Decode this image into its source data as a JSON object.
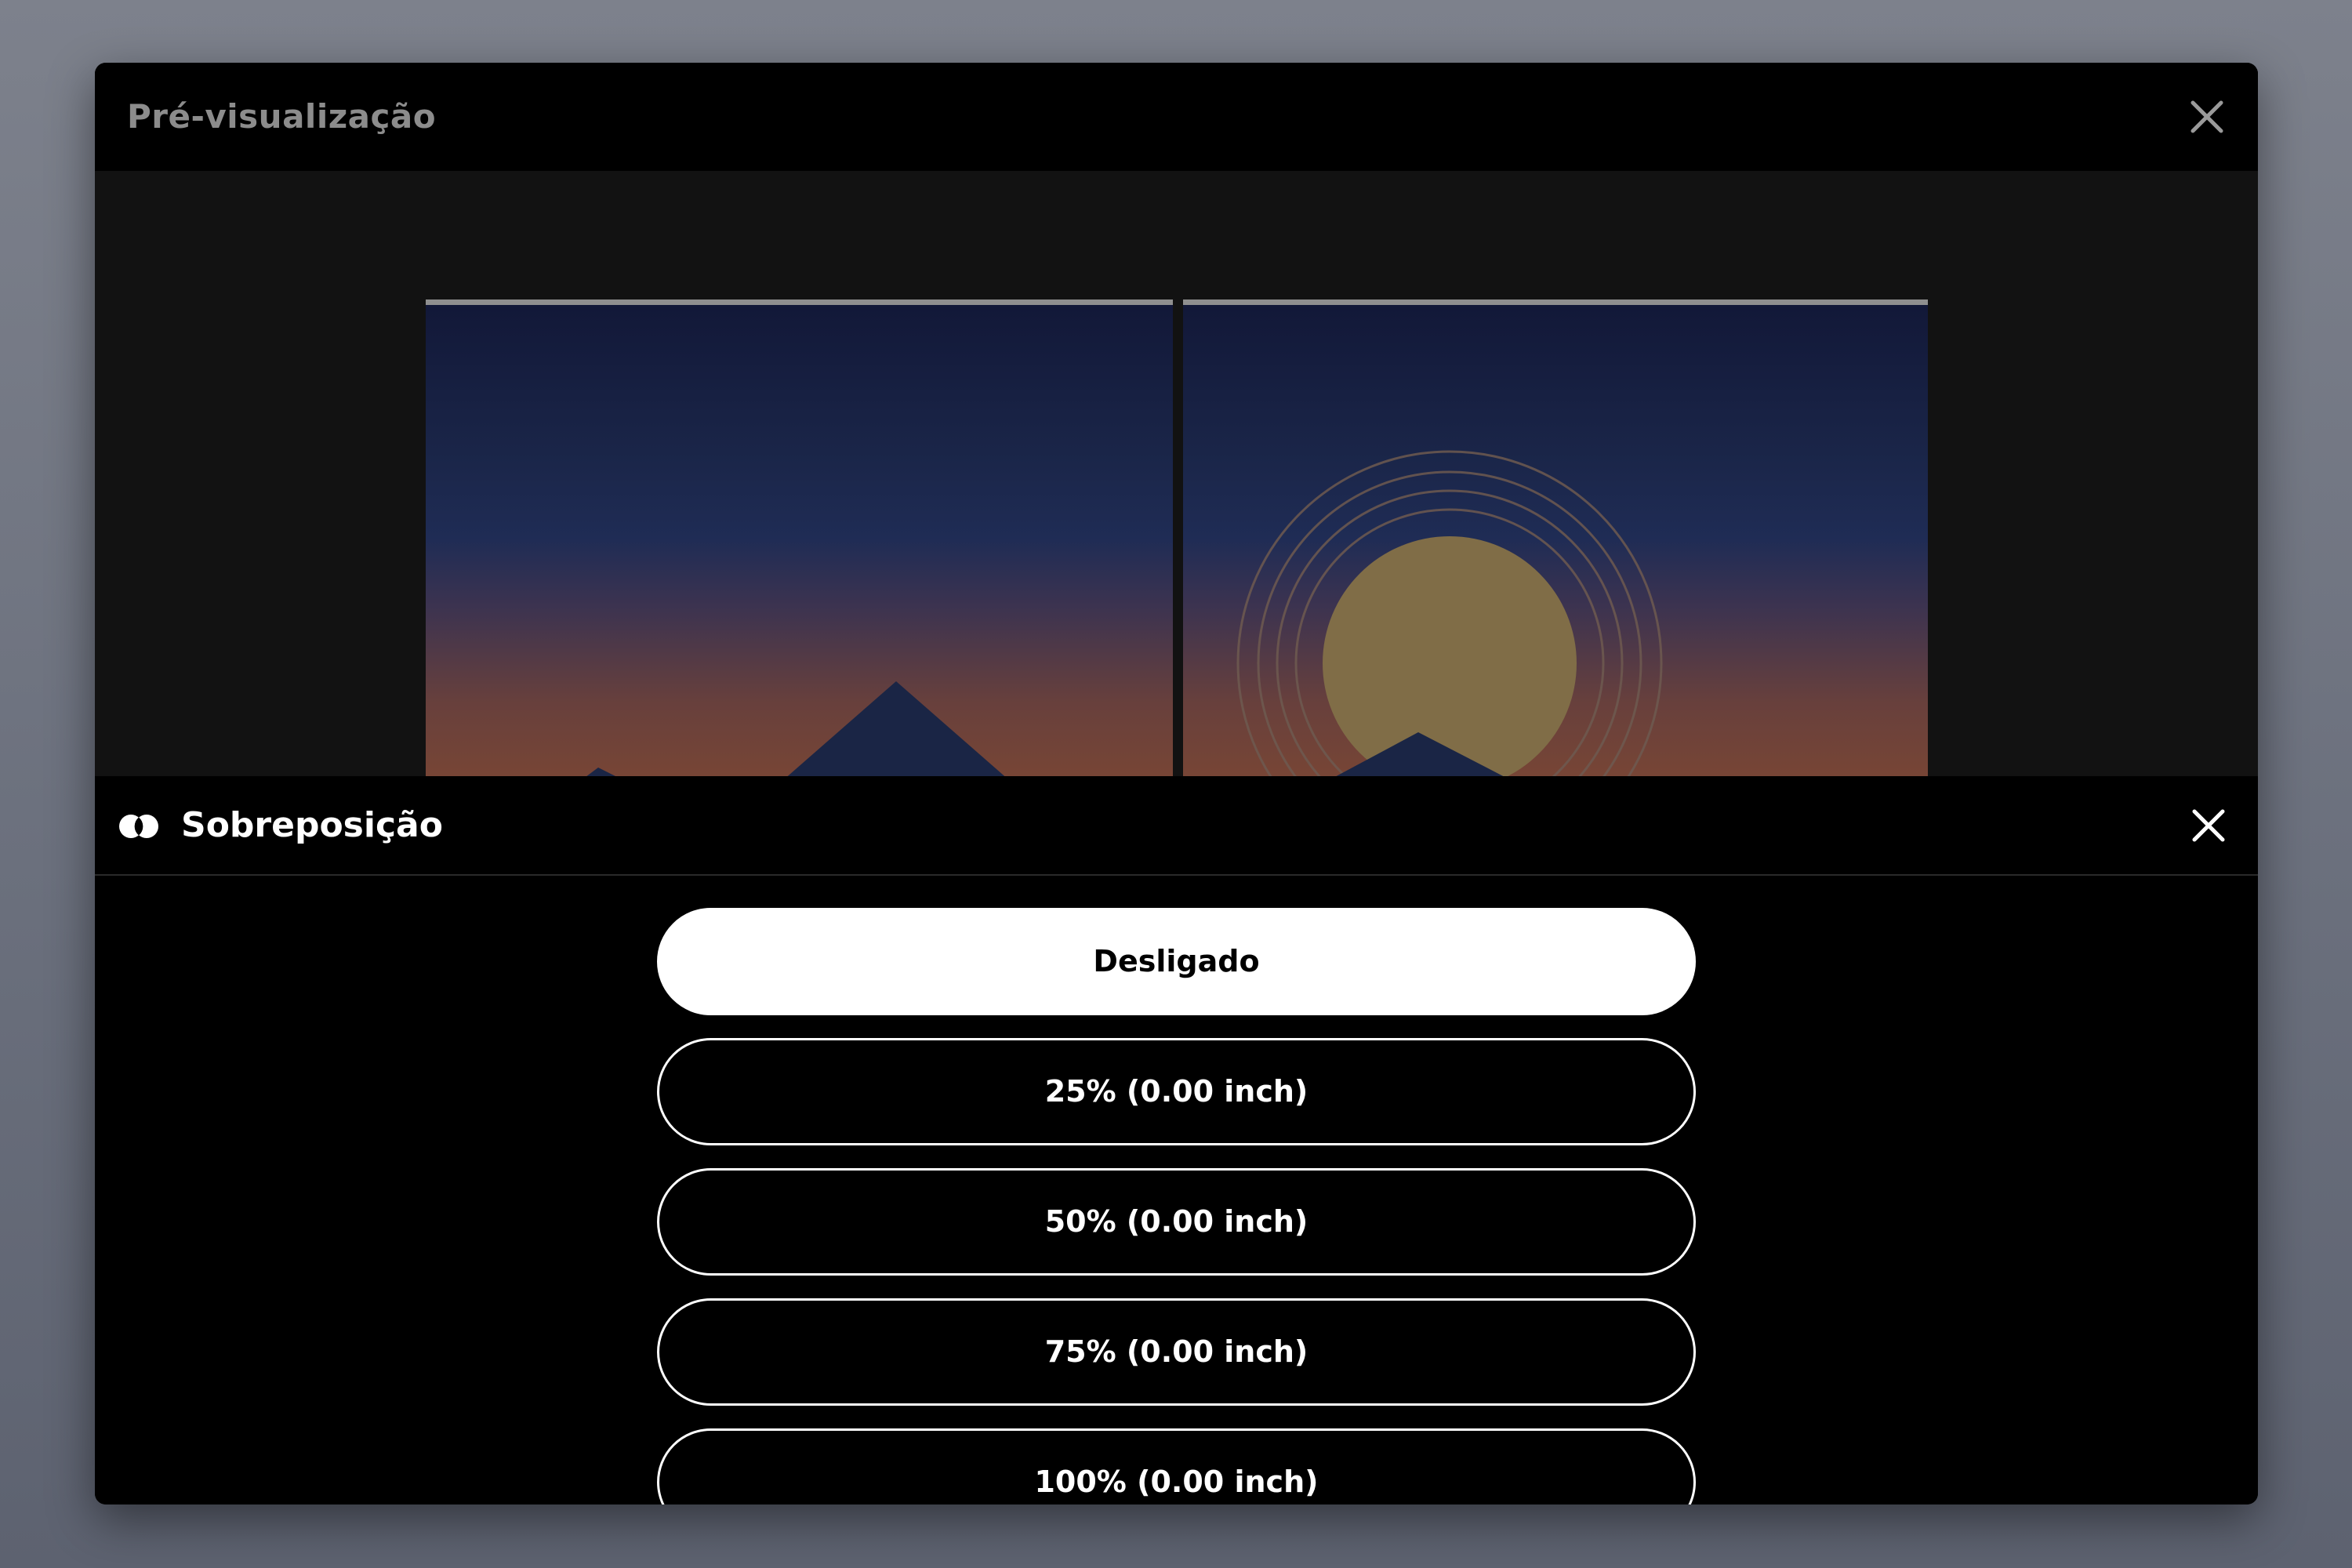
{
  "modal": {
    "title": "Pré-visualização",
    "close_icon": "close-icon"
  },
  "preview": {
    "panels": 2,
    "sun_color": "#806d47"
  },
  "overlap": {
    "icon": "overlap-circles-icon",
    "title": "Sobreposição",
    "close_icon": "close-icon",
    "options": [
      {
        "label": "Desligado",
        "selected": true
      },
      {
        "label": "25% (0.00 inch)",
        "selected": false
      },
      {
        "label": "50% (0.00 inch)",
        "selected": false
      },
      {
        "label": "75% (0.00 inch)",
        "selected": false
      },
      {
        "label": "100% (0.00 inch)",
        "selected": false
      }
    ]
  }
}
